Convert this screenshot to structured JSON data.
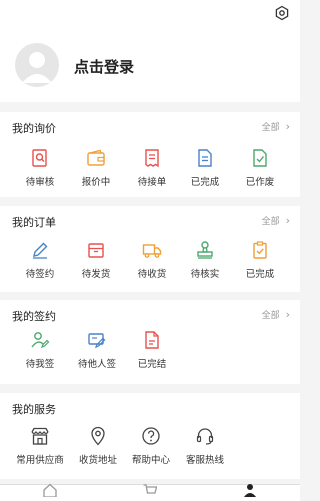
{
  "profile": {
    "login_label": "点击登录"
  },
  "colors": {
    "red": "#e8514e",
    "orange": "#f0a038",
    "blue": "#4a82c8",
    "green": "#4ca86b",
    "gray": "#999999"
  },
  "inquiry": {
    "title": "我的询价",
    "more_label": "全部",
    "items": [
      {
        "label": "待审核",
        "icon": "magnifier-doc-icon"
      },
      {
        "label": "报价中",
        "icon": "wallet-icon"
      },
      {
        "label": "待接单",
        "icon": "receipt-icon"
      },
      {
        "label": "已完成",
        "icon": "doc-done-icon"
      },
      {
        "label": "已作废",
        "icon": "doc-void-icon"
      }
    ]
  },
  "orders": {
    "title": "我的订单",
    "more_label": "全部",
    "items": [
      {
        "label": "待签约",
        "icon": "pen-icon"
      },
      {
        "label": "待发货",
        "icon": "box-icon"
      },
      {
        "label": "待收货",
        "icon": "truck-icon"
      },
      {
        "label": "待核实",
        "icon": "stamp-icon"
      },
      {
        "label": "已完成",
        "icon": "clipboard-check-icon"
      }
    ]
  },
  "contracts": {
    "title": "我的签约",
    "more_label": "全部",
    "items": [
      {
        "label": "待我签",
        "icon": "sign-user-icon"
      },
      {
        "label": "待他人签",
        "icon": "sign-other-icon"
      },
      {
        "label": "已完结",
        "icon": "doc-finished-icon"
      }
    ]
  },
  "services": {
    "title": "我的服务",
    "items": [
      {
        "label": "常用供应商",
        "icon": "shop-icon"
      },
      {
        "label": "收货地址",
        "icon": "location-icon"
      },
      {
        "label": "帮助中心",
        "icon": "help-icon"
      },
      {
        "label": "客服热线",
        "icon": "headset-icon"
      }
    ]
  },
  "tabbar": {
    "items": [
      {
        "icon": "home-icon"
      },
      {
        "icon": "cart-icon"
      },
      {
        "icon": "user-icon"
      }
    ]
  }
}
